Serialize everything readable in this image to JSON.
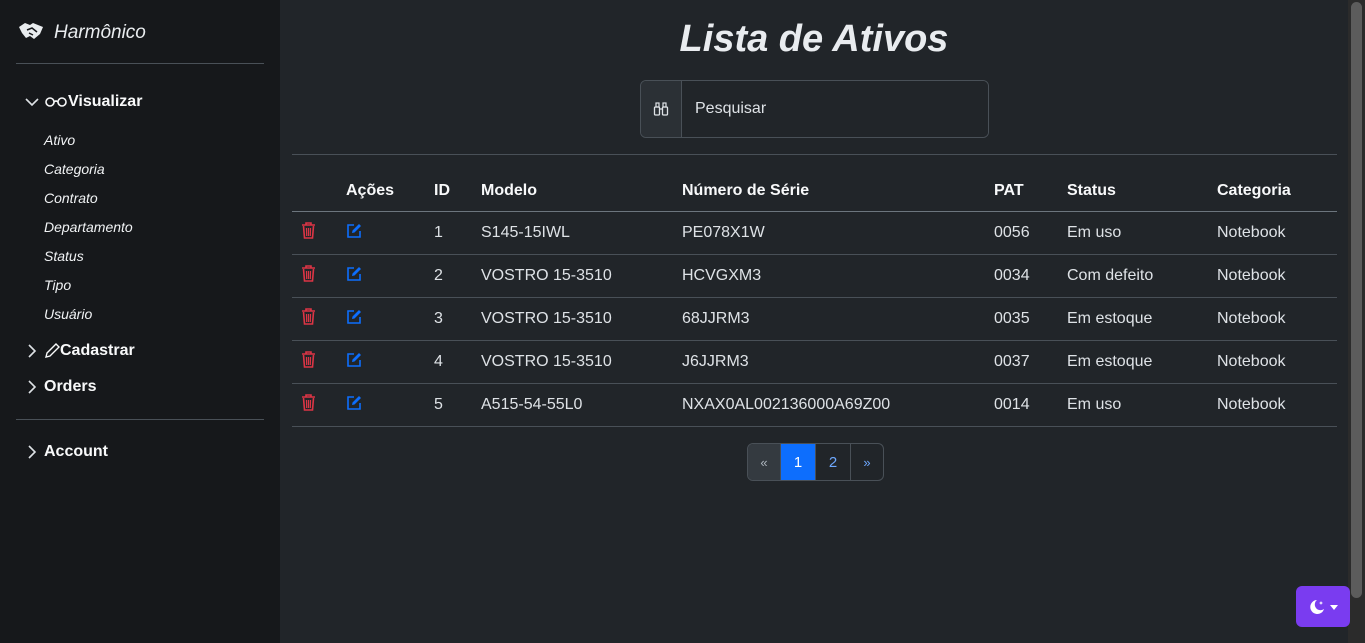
{
  "brand": {
    "name": "Harmônico",
    "icon": "handshake-icon"
  },
  "sidebar": {
    "groups": [
      {
        "label": "Visualizar",
        "icon": "glasses-icon",
        "expanded": true,
        "items": [
          "Ativo",
          "Categoria",
          "Contrato",
          "Departamento",
          "Status",
          "Tipo",
          "Usuário"
        ]
      },
      {
        "label": "Cadastrar",
        "icon": "pencil-icon",
        "expanded": false
      },
      {
        "label": "Orders",
        "expanded": false
      }
    ],
    "account_label": "Account"
  },
  "page": {
    "title": "Lista de Ativos",
    "search_placeholder": "Pesquisar",
    "search_icon": "binoculars-icon"
  },
  "table": {
    "columns": [
      "",
      "Ações",
      "ID",
      "Modelo",
      "Número de Série",
      "PAT",
      "Status",
      "Categoria"
    ],
    "rows": [
      {
        "id": "1",
        "modelo": "S145-15IWL",
        "serie": "PE078X1W",
        "pat": "0056",
        "status": "Em uso",
        "categoria": "Notebook"
      },
      {
        "id": "2",
        "modelo": "VOSTRO 15-3510",
        "serie": "HCVGXM3",
        "pat": "0034",
        "status": "Com defeito",
        "categoria": "Notebook"
      },
      {
        "id": "3",
        "modelo": "VOSTRO 15-3510",
        "serie": "68JJRM3",
        "pat": "0035",
        "status": "Em estoque",
        "categoria": "Notebook"
      },
      {
        "id": "4",
        "modelo": "VOSTRO 15-3510",
        "serie": "J6JJRM3",
        "pat": "0037",
        "status": "Em estoque",
        "categoria": "Notebook"
      },
      {
        "id": "5",
        "modelo": "A515-54-55L0",
        "serie": "NXAX0AL002136000A69Z00",
        "pat": "0014",
        "status": "Em uso",
        "categoria": "Notebook"
      }
    ],
    "delete_icon": "trash-icon",
    "edit_icon": "edit-icon"
  },
  "pagination": {
    "prev": "«",
    "pages": [
      "1",
      "2"
    ],
    "active": "1",
    "next": "»"
  },
  "theme_toggle": {
    "icon": "moon-stars-icon"
  },
  "colors": {
    "background": "#212529",
    "sidebar": "#16181b",
    "primary": "#0d6efd",
    "danger": "#dc3545",
    "theme_button": "#7a3cf0"
  }
}
